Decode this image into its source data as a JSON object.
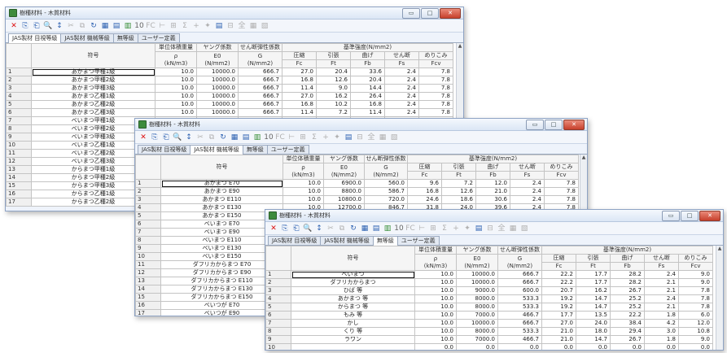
{
  "window_title": "樹種材料 - 木質材料",
  "window_buttons": {
    "minimize": "▭",
    "maximize": "□",
    "close": "✕"
  },
  "toolbar_icons": [
    "delete-icon",
    "copy-icon",
    "paste-icon",
    "search-icon",
    "sort-icon",
    "cut-icon",
    "copy2-icon",
    "refresh-icon",
    "grid-icon",
    "table-icon",
    "chart-icon",
    "number-icon",
    "fc-icon",
    "t-icon",
    "graph-icon",
    "sigma-icon",
    "plus-icon",
    "pin-icon",
    "layout-icon",
    "scale-icon",
    "calc-icon",
    "list-icon",
    "settings-icon"
  ],
  "toolbar_glyphs": [
    "✕",
    "⎘",
    "⎗",
    "🔍",
    "↕",
    "✂",
    "⧉",
    "↻",
    "▦",
    "▤",
    "▥",
    "10",
    "FC",
    "⊢",
    "⊞",
    "Σ",
    "+",
    "✦",
    "▤",
    "⊟",
    "全",
    "▦",
    "▧"
  ],
  "tabs": [
    "JAS製材 目視等級",
    "JAS製材 機械等級",
    "無等級",
    "ユーザー定義"
  ],
  "headers": {
    "symbol": "符号",
    "density": "単位体積重量",
    "density_sub1": "ρ",
    "density_sub2": "(kN/m3)",
    "young": "ヤング係数",
    "young_sub1": "E0",
    "young_sub2": "(N/mm2)",
    "shear": "せん断弾性係数",
    "shear_sub1": "G",
    "shear_sub2": "(N/mm2)",
    "strength_group": "基準強度(N/mm2)",
    "fc_1": "圧縮",
    "fc_2": "Fc",
    "ft_1": "引張",
    "ft_2": "Ft",
    "fb_1": "曲げ",
    "fb_2": "Fb",
    "fs_1": "せん断",
    "fs_2": "Fs",
    "fcv_1": "めりこみ",
    "fcv_2": "Fcv"
  },
  "windows": [
    {
      "active_tab": 0,
      "rows": [
        [
          "1",
          "あかまつ甲種1級",
          "10.0",
          "10000.0",
          "666.7",
          "27.0",
          "20.4",
          "33.6",
          "2.4",
          "7.8"
        ],
        [
          "2",
          "あかまつ甲種2級",
          "10.0",
          "10000.0",
          "666.7",
          "16.8",
          "12.6",
          "20.4",
          "2.4",
          "7.8"
        ],
        [
          "3",
          "あかまつ甲種3級",
          "10.0",
          "10000.0",
          "666.7",
          "11.4",
          "9.0",
          "14.4",
          "2.4",
          "7.8"
        ],
        [
          "4",
          "あかまつ乙種1級",
          "10.0",
          "10000.0",
          "666.7",
          "27.0",
          "16.2",
          "26.4",
          "2.4",
          "7.8"
        ],
        [
          "5",
          "あかまつ乙種2級",
          "10.0",
          "10000.0",
          "666.7",
          "16.8",
          "10.2",
          "16.8",
          "2.4",
          "7.8"
        ],
        [
          "6",
          "あかまつ乙種3級",
          "10.0",
          "10000.0",
          "666.7",
          "11.4",
          "7.2",
          "11.4",
          "2.4",
          "7.8"
        ],
        [
          "7",
          "べいまつ甲種1級",
          "",
          "",
          "",
          "",
          "",
          "",
          "",
          ""
        ],
        [
          "8",
          "べいまつ甲種2級",
          "",
          "",
          "",
          "",
          "",
          "",
          "",
          ""
        ],
        [
          "9",
          "べいまつ甲種3級",
          "",
          "",
          "",
          "",
          "",
          "",
          "",
          ""
        ],
        [
          "10",
          "べいまつ乙種1級",
          "",
          "",
          "",
          "",
          "",
          "",
          "",
          ""
        ],
        [
          "11",
          "べいまつ乙種2級",
          "",
          "",
          "",
          "",
          "",
          "",
          "",
          ""
        ],
        [
          "12",
          "べいまつ乙種3級",
          "",
          "",
          "",
          "",
          "",
          "",
          "",
          ""
        ],
        [
          "13",
          "からまつ甲種1級",
          "",
          "",
          "",
          "",
          "",
          "",
          "",
          ""
        ],
        [
          "14",
          "からまつ甲種2級",
          "",
          "",
          "",
          "",
          "",
          "",
          "",
          ""
        ],
        [
          "15",
          "からまつ甲種3級",
          "",
          "",
          "",
          "",
          "",
          "",
          "",
          ""
        ],
        [
          "16",
          "からまつ乙種1級",
          "",
          "",
          "",
          "",
          "",
          "",
          "",
          ""
        ],
        [
          "17",
          "からまつ乙種2級",
          "",
          "",
          "",
          "",
          "",
          "",
          "",
          ""
        ]
      ]
    },
    {
      "active_tab": 1,
      "rows": [
        [
          "1",
          "あかまつ E70",
          "10.0",
          "6900.0",
          "560.0",
          "9.6",
          "7.2",
          "12.0",
          "2.4",
          "7.8"
        ],
        [
          "2",
          "あかまつ E90",
          "10.0",
          "8800.0",
          "586.7",
          "16.8",
          "12.6",
          "21.0",
          "2.4",
          "7.8"
        ],
        [
          "3",
          "あかまつ E110",
          "10.0",
          "10800.0",
          "720.0",
          "24.6",
          "18.6",
          "30.6",
          "2.4",
          "7.8"
        ],
        [
          "4",
          "あかまつ E130",
          "10.0",
          "12700.0",
          "846.7",
          "31.8",
          "24.0",
          "39.6",
          "2.4",
          "7.8"
        ],
        [
          "5",
          "あかまつ E150",
          "",
          "",
          "",
          "",
          "",
          "",
          "",
          ""
        ],
        [
          "6",
          "べいまつ E70",
          "",
          "",
          "",
          "",
          "",
          "",
          "",
          ""
        ],
        [
          "7",
          "べいまつ E90",
          "",
          "",
          "",
          "",
          "",
          "",
          "",
          ""
        ],
        [
          "8",
          "べいまつ E110",
          "",
          "",
          "",
          "",
          "",
          "",
          "",
          ""
        ],
        [
          "9",
          "べいまつ E130",
          "",
          "",
          "",
          "",
          "",
          "",
          "",
          ""
        ],
        [
          "10",
          "べいまつ E150",
          "",
          "",
          "",
          "",
          "",
          "",
          "",
          ""
        ],
        [
          "11",
          "ダフリカからまつ E70",
          "",
          "",
          "",
          "",
          "",
          "",
          "",
          ""
        ],
        [
          "12",
          "ダフリカからまつ E90",
          "",
          "",
          "",
          "",
          "",
          "",
          "",
          ""
        ],
        [
          "13",
          "ダフリカからまつ E110",
          "",
          "",
          "",
          "",
          "",
          "",
          "",
          ""
        ],
        [
          "14",
          "ダフリカからまつ E130",
          "",
          "",
          "",
          "",
          "",
          "",
          "",
          ""
        ],
        [
          "15",
          "ダフリカからまつ E150",
          "",
          "",
          "",
          "",
          "",
          "",
          "",
          ""
        ],
        [
          "16",
          "べいつが E70",
          "",
          "",
          "",
          "",
          "",
          "",
          "",
          ""
        ],
        [
          "17",
          "べいつが E90",
          "",
          "",
          "",
          "",
          "",
          "",
          "",
          ""
        ]
      ]
    },
    {
      "active_tab": 2,
      "rows": [
        [
          "1",
          "べいまつ",
          "10.0",
          "10000.0",
          "666.7",
          "22.2",
          "17.7",
          "28.2",
          "2.4",
          "9.0"
        ],
        [
          "2",
          "ダフリカからまつ",
          "10.0",
          "10000.0",
          "666.7",
          "22.2",
          "17.7",
          "28.2",
          "2.1",
          "9.0"
        ],
        [
          "3",
          "ひば 等",
          "10.0",
          "9000.0",
          "600.0",
          "20.7",
          "16.2",
          "26.7",
          "2.1",
          "7.8"
        ],
        [
          "4",
          "あかまつ 等",
          "10.0",
          "8000.0",
          "533.3",
          "19.2",
          "14.7",
          "25.2",
          "2.4",
          "7.8"
        ],
        [
          "5",
          "からまつ 等",
          "10.0",
          "8000.0",
          "533.3",
          "19.2",
          "14.7",
          "25.2",
          "2.1",
          "7.8"
        ],
        [
          "6",
          "もみ 等",
          "10.0",
          "7000.0",
          "466.7",
          "17.7",
          "13.5",
          "22.2",
          "1.8",
          "6.0"
        ],
        [
          "7",
          "かし",
          "10.0",
          "10000.0",
          "666.7",
          "27.0",
          "24.0",
          "38.4",
          "4.2",
          "12.0"
        ],
        [
          "8",
          "くり 等",
          "10.0",
          "8000.0",
          "533.3",
          "21.0",
          "18.0",
          "29.4",
          "3.0",
          "10.8"
        ],
        [
          "9",
          "ラワン",
          "10.0",
          "7000.0",
          "466.7",
          "21.0",
          "14.7",
          "26.7",
          "1.8",
          "9.0"
        ],
        [
          "10",
          "",
          "0.0",
          "0.0",
          "0.0",
          "0.0",
          "0.0",
          "0.0",
          "0.0",
          "0.0"
        ]
      ]
    }
  ]
}
